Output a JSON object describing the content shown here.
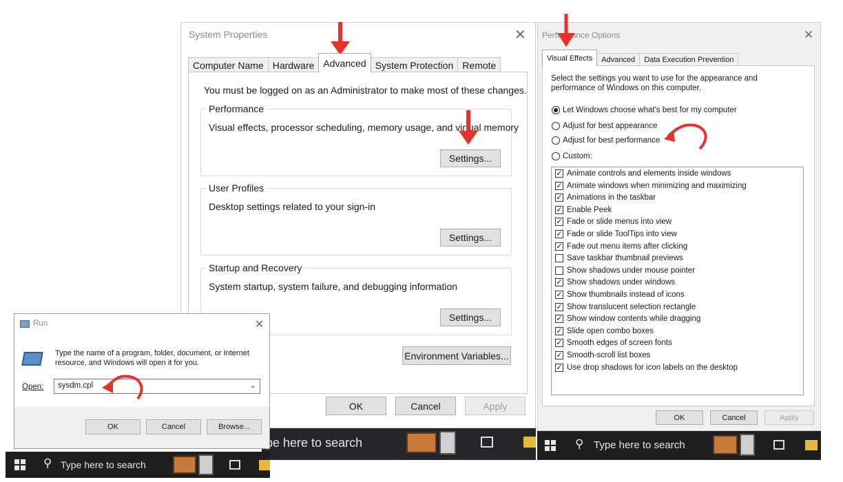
{
  "sysprops": {
    "title": "System Properties",
    "tabs": [
      "Computer Name",
      "Hardware",
      "Advanced",
      "System Protection",
      "Remote"
    ],
    "admin_note": "You must be logged on as an Administrator to make most of these changes.",
    "performance": {
      "legend": "Performance",
      "desc": "Visual effects, processor scheduling, memory usage, and virtual memory",
      "button": "Settings..."
    },
    "user_profiles": {
      "legend": "User Profiles",
      "desc": "Desktop settings related to your sign-in",
      "button": "Settings..."
    },
    "startup": {
      "legend": "Startup and Recovery",
      "desc": "System startup, system failure, and debugging information",
      "button": "Settings..."
    },
    "env_button": "Environment Variables...",
    "ok": "OK",
    "cancel": "Cancel",
    "apply": "Apply"
  },
  "perf": {
    "title": "Performance Options",
    "tabs": [
      "Visual Effects",
      "Advanced",
      "Data Execution Prevention"
    ],
    "intro": "Select the settings you want to use for the appearance and performance of Windows on this computer.",
    "radios": [
      {
        "label": "Let Windows choose what's best for my computer",
        "selected": true
      },
      {
        "label": "Adjust for best appearance",
        "selected": false
      },
      {
        "label": "Adjust for best performance",
        "selected": false
      },
      {
        "label": "Custom:",
        "selected": false
      }
    ],
    "effects": [
      {
        "label": "Animate controls and elements inside windows",
        "checked": true
      },
      {
        "label": "Animate windows when minimizing and maximizing",
        "checked": true
      },
      {
        "label": "Animations in the taskbar",
        "checked": true
      },
      {
        "label": "Enable Peek",
        "checked": true
      },
      {
        "label": "Fade or slide menus into view",
        "checked": true
      },
      {
        "label": "Fade or slide ToolTips into view",
        "checked": true
      },
      {
        "label": "Fade out menu items after clicking",
        "checked": true
      },
      {
        "label": "Save taskbar thumbnail previews",
        "checked": false
      },
      {
        "label": "Show shadows under mouse pointer",
        "checked": false
      },
      {
        "label": "Show shadows under windows",
        "checked": true
      },
      {
        "label": "Show thumbnails instead of icons",
        "checked": true
      },
      {
        "label": "Show translucent selection rectangle",
        "checked": true
      },
      {
        "label": "Show window contents while dragging",
        "checked": true
      },
      {
        "label": "Slide open combo boxes",
        "checked": true
      },
      {
        "label": "Smooth edges of screen fonts",
        "checked": true
      },
      {
        "label": "Smooth-scroll list boxes",
        "checked": true
      },
      {
        "label": "Use drop shadows for icon labels on the desktop",
        "checked": true
      }
    ],
    "ok": "OK",
    "cancel": "Cancel",
    "apply": "Apply"
  },
  "run": {
    "title": "Run",
    "desc": "Type the name of a program, folder, document, or Internet resource, and Windows will open it for you.",
    "open_label": "Open:",
    "open_value": "sysdm.cpl",
    "ok": "OK",
    "cancel": "Cancel",
    "browse": "Browse..."
  },
  "taskbars": {
    "left_search": "Type here to search",
    "middle_search": "pe here to search",
    "right_search": "Type here to search"
  },
  "colors": {
    "annotation_red": "#e5322d",
    "taskbar": "#1f1f1f"
  }
}
